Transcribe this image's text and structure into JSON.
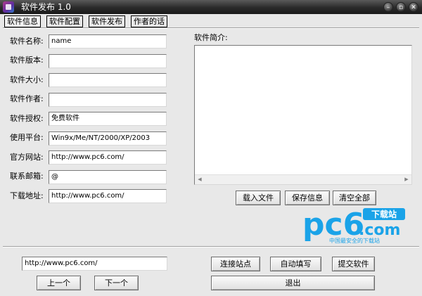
{
  "window": {
    "title": "软件发布 1.0"
  },
  "window_controls": {
    "minimize": "–",
    "restore": "▫",
    "close": "✕"
  },
  "tabs": [
    "软件信息",
    "软件配置",
    "软件发布",
    "作者的话"
  ],
  "form": {
    "name_label": "软件名称:",
    "name_value": "name",
    "version_label": "软件版本:",
    "version_value": "",
    "size_label": "软件大小:",
    "size_value": "",
    "author_label": "软件作者:",
    "author_value": "",
    "license_label": "软件授权:",
    "license_value": "免费软件",
    "platform_label": "使用平台:",
    "platform_value": "Win9x/Me/NT/2000/XP/2003",
    "website_label": "官方网站:",
    "website_value": "http://www.pc6.com/",
    "email_label": "联系邮箱:",
    "email_value": "@",
    "download_label": "下载地址:",
    "download_value": "http://www.pc6.com/"
  },
  "description": {
    "label": "软件简介:",
    "value": ""
  },
  "desc_buttons": {
    "load": "载入文件",
    "save": "保存信息",
    "clear": "清空全部"
  },
  "logo": {
    "brand": "pc6",
    "suffix": ".com",
    "badge": "下载站",
    "tagline": "中国最安全的下载站"
  },
  "bottom": {
    "url_value": "http://www.pc6.com/",
    "prev": "上一个",
    "next": "下一个",
    "connect": "连接站点",
    "autofill": "自动填写",
    "submit": "提交软件",
    "exit": "退出"
  }
}
